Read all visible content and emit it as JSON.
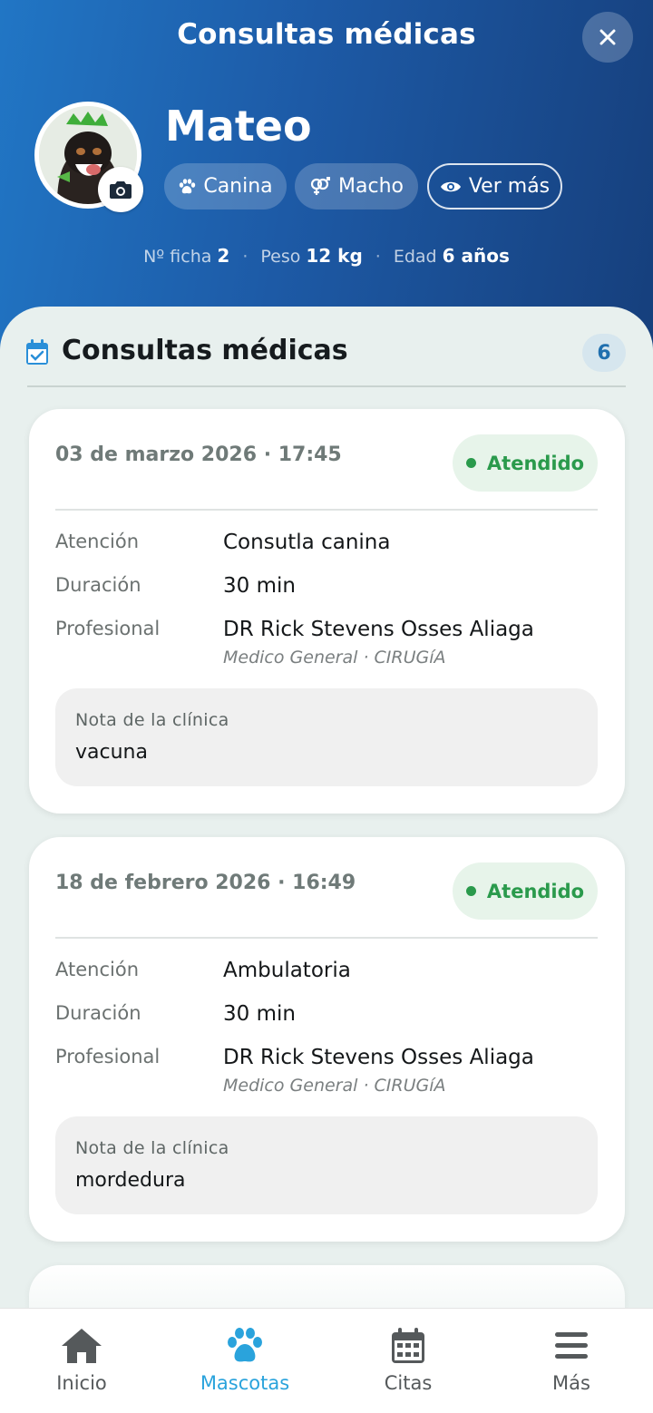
{
  "header": {
    "title": "Consultas médicas"
  },
  "pet": {
    "name": "Mateo",
    "chips": [
      {
        "label": "Canina",
        "icon": "paw-icon"
      },
      {
        "label": "Macho",
        "icon": "gender-icon"
      },
      {
        "label": "Ver más",
        "icon": "eye-icon"
      }
    ],
    "stats": [
      {
        "label": "Nº ficha",
        "value": "2"
      },
      {
        "label": "Peso",
        "value": "12 kg"
      },
      {
        "label": "Edad",
        "value": "6 años"
      }
    ]
  },
  "section": {
    "title": "Consultas médicas",
    "count": "6"
  },
  "consultations": [
    {
      "date": "03 de marzo 2026 · 17:45",
      "status": "Atendido",
      "rows": {
        "attention_label": "Atención",
        "attention": "Consutla canina",
        "duration_label": "Duración",
        "duration": "30 min",
        "professional_label": "Profesional",
        "professional": "DR Rick Stevens Osses Aliaga",
        "professional_sub": "Medico General · CIRUGíA"
      },
      "note_label": "Nota de la clínica",
      "note": "vacuna"
    },
    {
      "date": "18 de febrero 2026 · 16:49",
      "status": "Atendido",
      "rows": {
        "attention_label": "Atención",
        "attention": "Ambulatoria",
        "duration_label": "Duración",
        "duration": "30 min",
        "professional_label": "Profesional",
        "professional": "DR Rick Stevens Osses Aliaga",
        "professional_sub": "Medico General · CIRUGíA"
      },
      "note_label": "Nota de la clínica",
      "note": "mordedura"
    }
  ],
  "colors": {
    "primary": "#2aa3dc",
    "header_start": "#2176c5",
    "header_end": "#163f7c",
    "status_green": "#2a9a4c"
  },
  "bottom_nav": [
    {
      "label": "Inicio",
      "icon": "home-icon"
    },
    {
      "label": "Mascotas",
      "icon": "paw-icon",
      "active": true
    },
    {
      "label": "Citas",
      "icon": "calendar-icon"
    },
    {
      "label": "Más",
      "icon": "menu-icon"
    }
  ]
}
